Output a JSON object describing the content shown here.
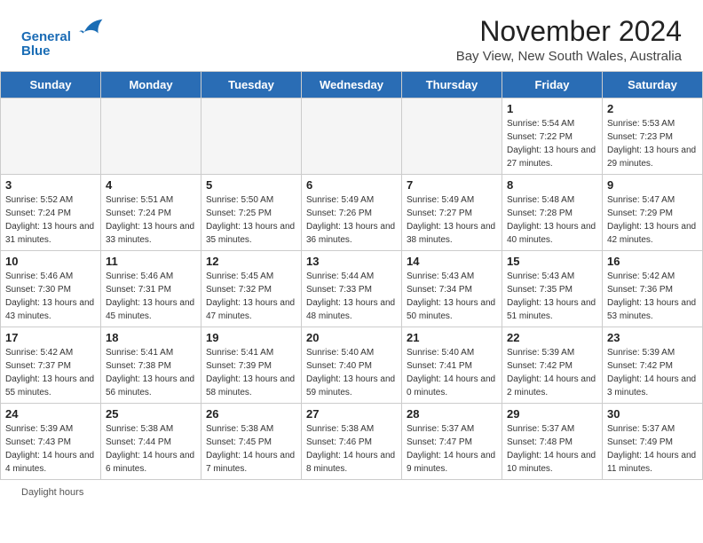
{
  "header": {
    "logo_line1": "General",
    "logo_line2": "Blue",
    "title": "November 2024",
    "subtitle": "Bay View, New South Wales, Australia"
  },
  "calendar": {
    "days_of_week": [
      "Sunday",
      "Monday",
      "Tuesday",
      "Wednesday",
      "Thursday",
      "Friday",
      "Saturday"
    ],
    "weeks": [
      [
        {
          "day": "",
          "info": ""
        },
        {
          "day": "",
          "info": ""
        },
        {
          "day": "",
          "info": ""
        },
        {
          "day": "",
          "info": ""
        },
        {
          "day": "",
          "info": ""
        },
        {
          "day": "1",
          "info": "Sunrise: 5:54 AM\nSunset: 7:22 PM\nDaylight: 13 hours and 27 minutes."
        },
        {
          "day": "2",
          "info": "Sunrise: 5:53 AM\nSunset: 7:23 PM\nDaylight: 13 hours and 29 minutes."
        }
      ],
      [
        {
          "day": "3",
          "info": "Sunrise: 5:52 AM\nSunset: 7:24 PM\nDaylight: 13 hours and 31 minutes."
        },
        {
          "day": "4",
          "info": "Sunrise: 5:51 AM\nSunset: 7:24 PM\nDaylight: 13 hours and 33 minutes."
        },
        {
          "day": "5",
          "info": "Sunrise: 5:50 AM\nSunset: 7:25 PM\nDaylight: 13 hours and 35 minutes."
        },
        {
          "day": "6",
          "info": "Sunrise: 5:49 AM\nSunset: 7:26 PM\nDaylight: 13 hours and 36 minutes."
        },
        {
          "day": "7",
          "info": "Sunrise: 5:49 AM\nSunset: 7:27 PM\nDaylight: 13 hours and 38 minutes."
        },
        {
          "day": "8",
          "info": "Sunrise: 5:48 AM\nSunset: 7:28 PM\nDaylight: 13 hours and 40 minutes."
        },
        {
          "day": "9",
          "info": "Sunrise: 5:47 AM\nSunset: 7:29 PM\nDaylight: 13 hours and 42 minutes."
        }
      ],
      [
        {
          "day": "10",
          "info": "Sunrise: 5:46 AM\nSunset: 7:30 PM\nDaylight: 13 hours and 43 minutes."
        },
        {
          "day": "11",
          "info": "Sunrise: 5:46 AM\nSunset: 7:31 PM\nDaylight: 13 hours and 45 minutes."
        },
        {
          "day": "12",
          "info": "Sunrise: 5:45 AM\nSunset: 7:32 PM\nDaylight: 13 hours and 47 minutes."
        },
        {
          "day": "13",
          "info": "Sunrise: 5:44 AM\nSunset: 7:33 PM\nDaylight: 13 hours and 48 minutes."
        },
        {
          "day": "14",
          "info": "Sunrise: 5:43 AM\nSunset: 7:34 PM\nDaylight: 13 hours and 50 minutes."
        },
        {
          "day": "15",
          "info": "Sunrise: 5:43 AM\nSunset: 7:35 PM\nDaylight: 13 hours and 51 minutes."
        },
        {
          "day": "16",
          "info": "Sunrise: 5:42 AM\nSunset: 7:36 PM\nDaylight: 13 hours and 53 minutes."
        }
      ],
      [
        {
          "day": "17",
          "info": "Sunrise: 5:42 AM\nSunset: 7:37 PM\nDaylight: 13 hours and 55 minutes."
        },
        {
          "day": "18",
          "info": "Sunrise: 5:41 AM\nSunset: 7:38 PM\nDaylight: 13 hours and 56 minutes."
        },
        {
          "day": "19",
          "info": "Sunrise: 5:41 AM\nSunset: 7:39 PM\nDaylight: 13 hours and 58 minutes."
        },
        {
          "day": "20",
          "info": "Sunrise: 5:40 AM\nSunset: 7:40 PM\nDaylight: 13 hours and 59 minutes."
        },
        {
          "day": "21",
          "info": "Sunrise: 5:40 AM\nSunset: 7:41 PM\nDaylight: 14 hours and 0 minutes."
        },
        {
          "day": "22",
          "info": "Sunrise: 5:39 AM\nSunset: 7:42 PM\nDaylight: 14 hours and 2 minutes."
        },
        {
          "day": "23",
          "info": "Sunrise: 5:39 AM\nSunset: 7:42 PM\nDaylight: 14 hours and 3 minutes."
        }
      ],
      [
        {
          "day": "24",
          "info": "Sunrise: 5:39 AM\nSunset: 7:43 PM\nDaylight: 14 hours and 4 minutes."
        },
        {
          "day": "25",
          "info": "Sunrise: 5:38 AM\nSunset: 7:44 PM\nDaylight: 14 hours and 6 minutes."
        },
        {
          "day": "26",
          "info": "Sunrise: 5:38 AM\nSunset: 7:45 PM\nDaylight: 14 hours and 7 minutes."
        },
        {
          "day": "27",
          "info": "Sunrise: 5:38 AM\nSunset: 7:46 PM\nDaylight: 14 hours and 8 minutes."
        },
        {
          "day": "28",
          "info": "Sunrise: 5:37 AM\nSunset: 7:47 PM\nDaylight: 14 hours and 9 minutes."
        },
        {
          "day": "29",
          "info": "Sunrise: 5:37 AM\nSunset: 7:48 PM\nDaylight: 14 hours and 10 minutes."
        },
        {
          "day": "30",
          "info": "Sunrise: 5:37 AM\nSunset: 7:49 PM\nDaylight: 14 hours and 11 minutes."
        }
      ]
    ]
  },
  "footer": {
    "daylight_label": "Daylight hours"
  }
}
